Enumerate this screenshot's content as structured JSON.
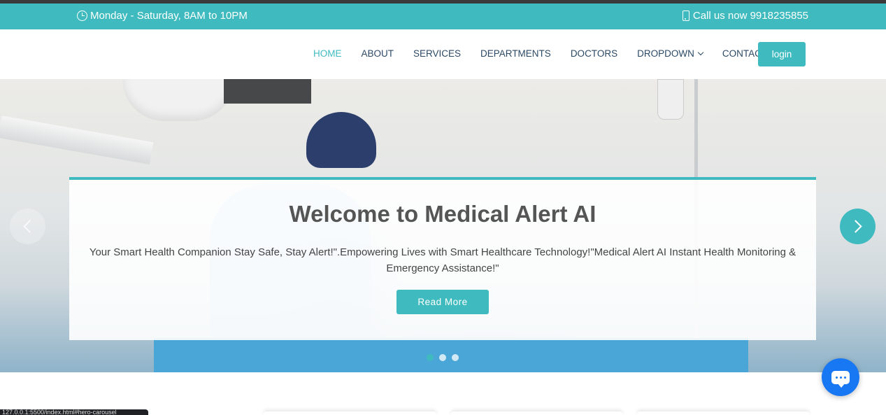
{
  "topbar": {
    "hours": "Monday - Saturday, 8AM to 10PM",
    "phone": "Call us now 9918235855",
    "clock_icon": "clock-icon",
    "phone_icon": "phone-icon"
  },
  "nav": {
    "items": [
      "HOME",
      "ABOUT",
      "SERVICES",
      "DEPARTMENTS",
      "DOCTORS",
      "DROPDOWN",
      "CONTACT"
    ],
    "active": "HOME",
    "login_label": "login"
  },
  "hero": {
    "title": "Welcome to Medical Alert AI",
    "text": "Your Smart Health Companion Stay Safe, Stay Alert!\".Empowering Lives with Smart Healthcare Technology!\"Medical Alert AI Instant Health Monitoring & Emergency Assistance!\"",
    "button_label": "Read More",
    "slides": 3,
    "active_slide": 1
  },
  "status_bar": {
    "url": "127.0.0.1:5500/index.html#hero-carousel"
  },
  "colors": {
    "accent": "#3fbbc0",
    "nav_text": "#2c4964",
    "chat_button": "#1877f2"
  }
}
